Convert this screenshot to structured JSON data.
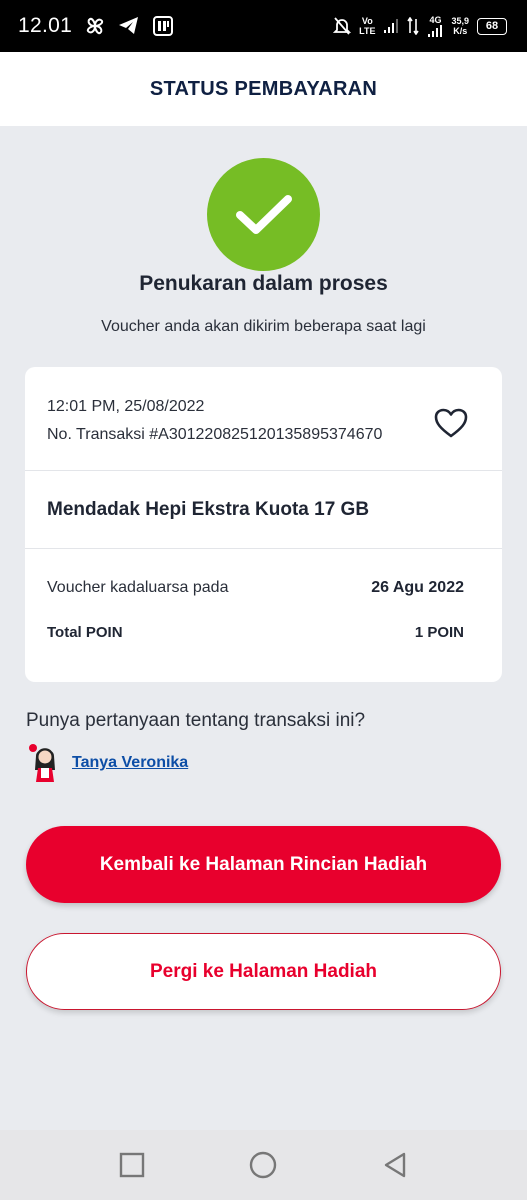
{
  "status_bar": {
    "time": "12.01",
    "network_top": "Vo",
    "network_bottom": "LTE",
    "net_type": "4G",
    "speed_top": "35,9",
    "speed_bottom": "K/s",
    "battery": "68"
  },
  "header": {
    "title": "STATUS PEMBAYARAN"
  },
  "success": {
    "title": "Penukaran dalam proses",
    "subtitle": "Voucher anda akan dikirim beberapa saat lagi",
    "color": "#76bd25"
  },
  "transaction": {
    "datetime": "12:01 PM, 25/08/2022",
    "number_label": "No. Transaksi #A3012208251201358953746​70",
    "product": "Mendadak Hepi Ekstra Kuota 17 GB",
    "expiry_label": "Voucher kadaluarsa pada",
    "expiry_value": "26 Agu 2022",
    "points_label": "Total POIN",
    "points_value": "1 POIN"
  },
  "help": {
    "question": "Punya pertanyaan tentang transaksi ini?",
    "link": "Tanya Veronika"
  },
  "buttons": {
    "primary": "Kembali ke Halaman Rincian Hadiah",
    "secondary": "Pergi ke Halaman Hadiah"
  },
  "colors": {
    "brand_red": "#e8002d",
    "link_blue": "#0d4ea6",
    "header_navy": "#0f2042"
  }
}
